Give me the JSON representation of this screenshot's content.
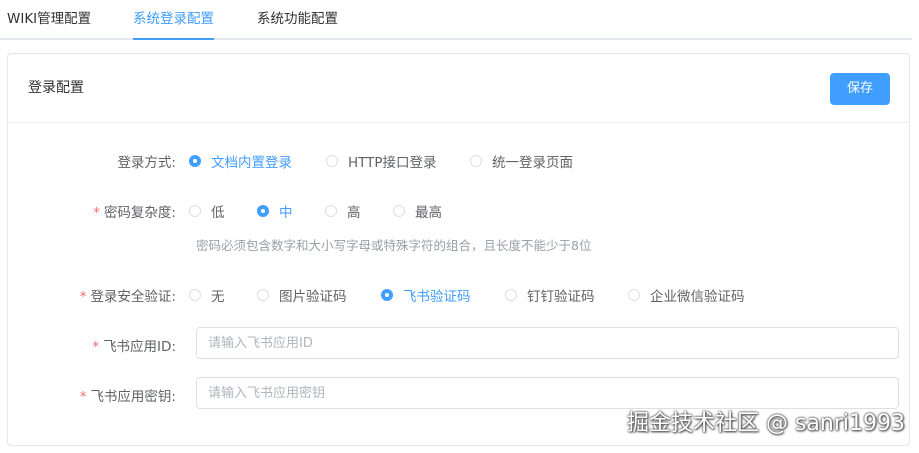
{
  "tabs": [
    {
      "label": "WIKI管理配置",
      "active": false
    },
    {
      "label": "系统登录配置",
      "active": true
    },
    {
      "label": "系统功能配置",
      "active": false
    }
  ],
  "card": {
    "title": "登录配置",
    "save_label": "保存"
  },
  "form": {
    "login_method": {
      "label": "登录方式:",
      "required": false,
      "options": [
        "文档内置登录",
        "HTTP接口登录",
        "统一登录页面"
      ],
      "selected": "文档内置登录"
    },
    "password_complexity": {
      "label": "密码复杂度:",
      "required": true,
      "options": [
        "低",
        "中",
        "高",
        "最高"
      ],
      "selected": "中",
      "hint": "密码必须包含数字和大小写字母或特殊字符的组合，且长度不能少于8位"
    },
    "login_verification": {
      "label": "登录安全验证:",
      "required": true,
      "options": [
        "无",
        "图片验证码",
        "飞书验证码",
        "钉钉验证码",
        "企业微信验证码"
      ],
      "selected": "飞书验证码"
    },
    "feishu_app_id": {
      "label": "飞书应用ID:",
      "required": true,
      "value": "",
      "placeholder": "请输入飞书应用ID"
    },
    "feishu_app_secret": {
      "label": "飞书应用密钥:",
      "required": true,
      "value": "",
      "placeholder": "请输入飞书应用密钥"
    }
  },
  "watermark": "掘金技术社区 @ sanri1993",
  "colors": {
    "accent": "#409eff",
    "required": "#f56c6c"
  }
}
